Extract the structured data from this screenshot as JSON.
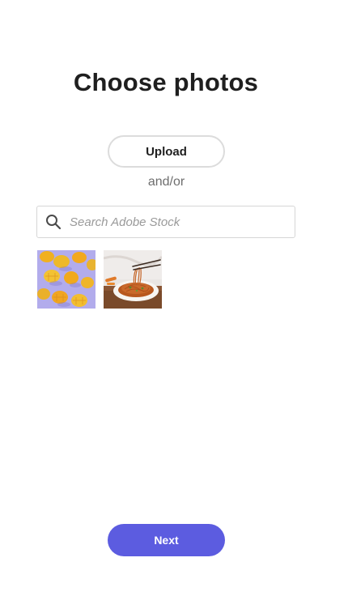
{
  "header": {
    "title": "Choose photos"
  },
  "upload": {
    "label": "Upload"
  },
  "separator": {
    "text": "and/or"
  },
  "search": {
    "placeholder": "Search Adobe Stock",
    "value": "",
    "icon": "search-icon"
  },
  "photos": [
    {
      "subject": "mangoes",
      "icon": "mango-photo-thumbnail"
    },
    {
      "subject": "noodles",
      "icon": "noodles-photo-thumbnail"
    }
  ],
  "footer": {
    "next_label": "Next"
  },
  "colors": {
    "accent": "#5c5ce0",
    "title": "#1f1f1f",
    "muted": "#6e6e6e",
    "border": "#d6d6d6"
  }
}
